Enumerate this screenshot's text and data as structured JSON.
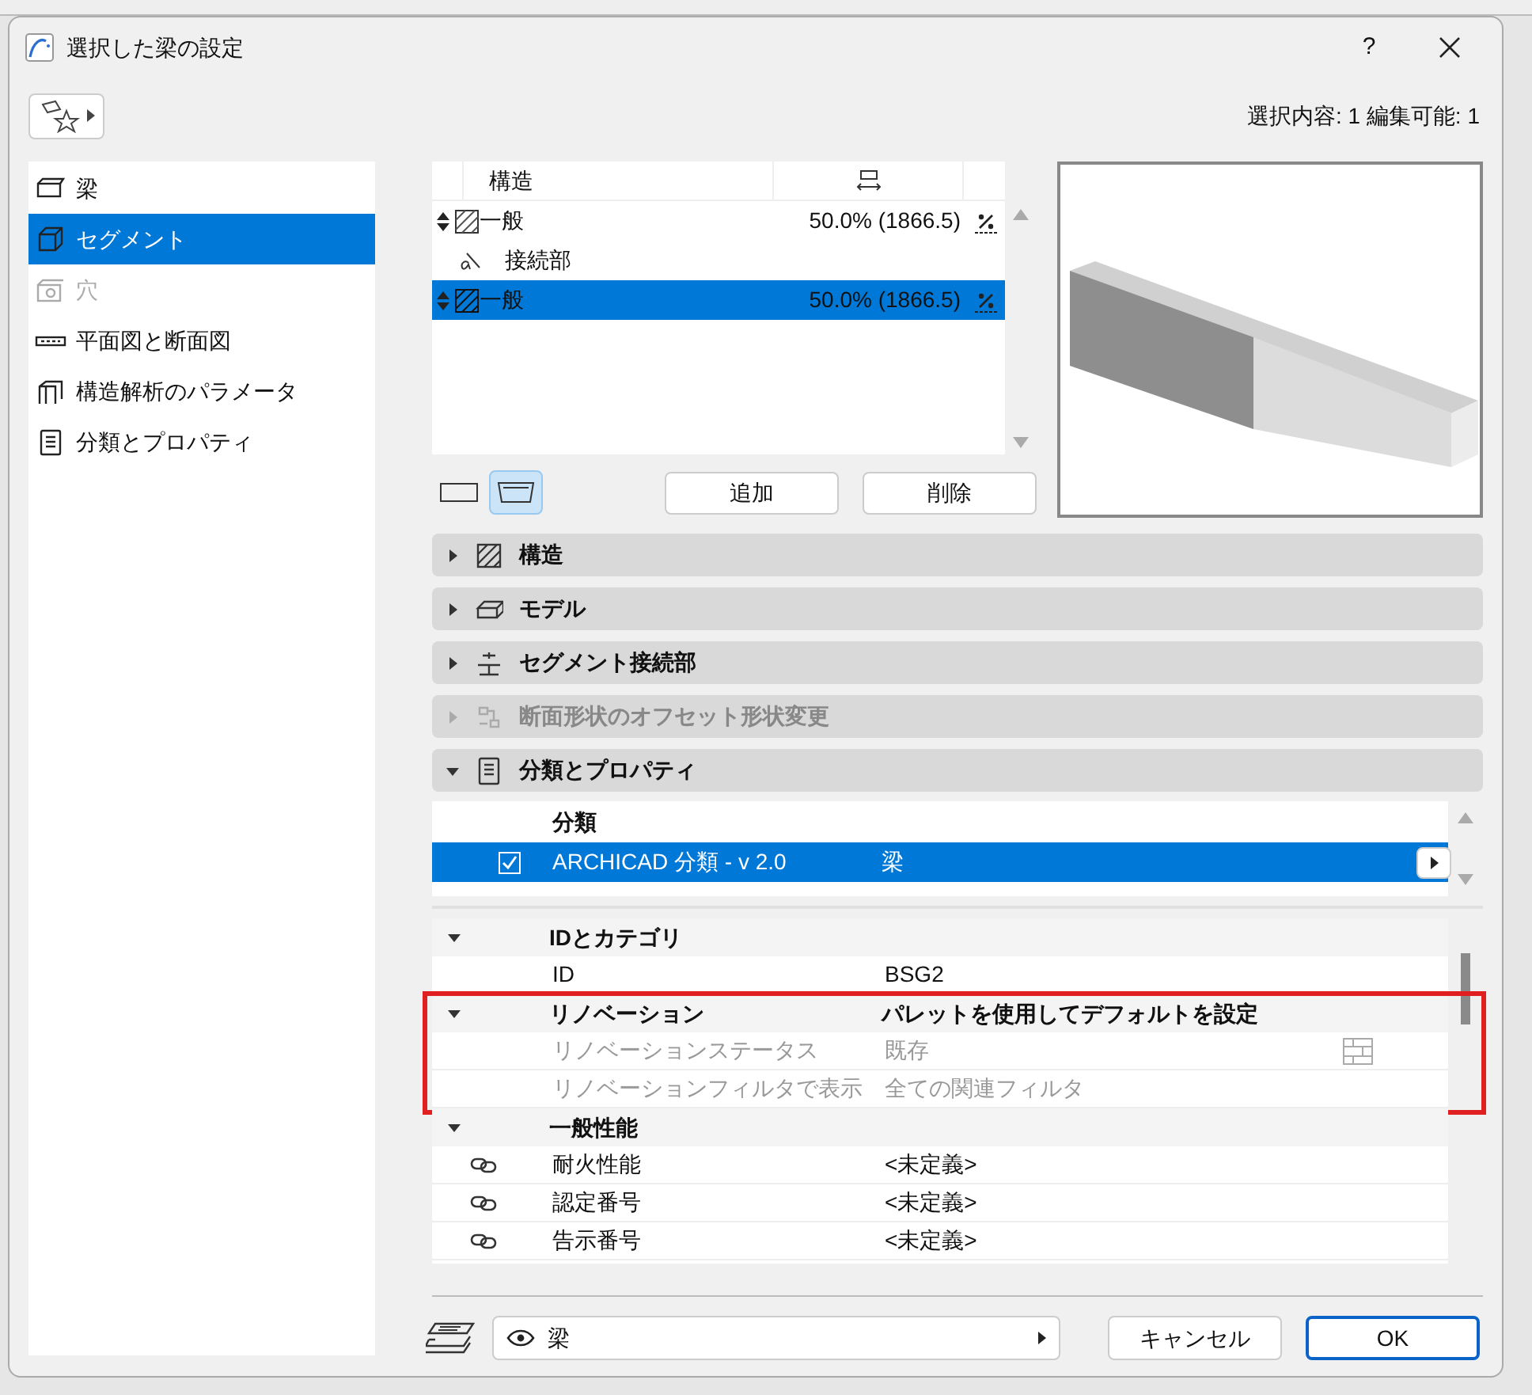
{
  "window": {
    "title": "選択した梁の設定",
    "help": "?"
  },
  "selection_info": "選択内容: 1 編集可能: 1",
  "sidebar": {
    "items": [
      {
        "kind": "beam",
        "label": "梁",
        "selected": false,
        "disabled": false
      },
      {
        "kind": "segment",
        "label": "セグメント",
        "selected": true,
        "disabled": false
      },
      {
        "kind": "hole",
        "label": "穴",
        "selected": false,
        "disabled": true
      },
      {
        "kind": "plan",
        "label": "平面図と断面図",
        "selected": false,
        "disabled": false
      },
      {
        "kind": "analysis",
        "label": "構造解析のパラメータ",
        "selected": false,
        "disabled": false
      },
      {
        "kind": "properties",
        "label": "分類とプロパティ",
        "selected": false,
        "disabled": false
      }
    ]
  },
  "segments": {
    "header": "構造",
    "rows": [
      {
        "kind": "segment",
        "name": "一般",
        "value": "50.0% (1866.5)",
        "selected": false
      },
      {
        "kind": "joint",
        "name": "接続部",
        "selected": false
      },
      {
        "kind": "segment",
        "name": "一般",
        "value": "50.0% (1866.5)",
        "selected": true
      }
    ]
  },
  "view_toggles": [
    {
      "kind": "flat",
      "selected": false
    },
    {
      "kind": "tapered",
      "selected": true
    }
  ],
  "segment_buttons": [
    "追加",
    "削除"
  ],
  "panels": [
    {
      "kind": "structure",
      "title": "構造",
      "expanded": false,
      "disabled": false
    },
    {
      "kind": "model",
      "title": "モデル",
      "expanded": false,
      "disabled": false
    },
    {
      "kind": "joint",
      "title": "セグメント接続部",
      "expanded": false,
      "disabled": false
    },
    {
      "kind": "offset",
      "title": "断面形状のオフセット形状変更",
      "expanded": false,
      "disabled": true
    },
    {
      "kind": "properties",
      "title": "分類とプロパティ",
      "expanded": true,
      "disabled": false
    }
  ],
  "classification": {
    "header": "分類",
    "rows": [
      {
        "checked": true,
        "system": "ARCHICAD 分類 - v 2.0",
        "value": "梁",
        "selected": true
      }
    ]
  },
  "properties": {
    "groups": [
      {
        "title": "IDとカテゴリ",
        "expanded": true,
        "highlighted": false,
        "rows": [
          {
            "kind": "plain",
            "label": "ID",
            "value": "BSG2",
            "disabled": false
          }
        ]
      },
      {
        "title": "リノベーション",
        "value": "パレットを使用してデフォルトを設定",
        "expanded": true,
        "highlighted": true,
        "rows": [
          {
            "kind": "renovation",
            "label": "リノベーションステータス",
            "value": "既存",
            "disabled": true
          },
          {
            "kind": "plain",
            "label": "リノベーションフィルタで表示",
            "value": "全ての関連フィルタ",
            "disabled": true
          }
        ]
      },
      {
        "title": "一般性能",
        "expanded": true,
        "highlighted": false,
        "rows": [
          {
            "kind": "linked",
            "label": "耐火性能",
            "value": "<未定義>",
            "disabled": false
          },
          {
            "kind": "linked",
            "label": "認定番号",
            "value": "<未定義>",
            "disabled": false
          },
          {
            "kind": "linked",
            "label": "告示番号",
            "value": "<未定義>",
            "disabled": false
          }
        ]
      }
    ]
  },
  "footer": {
    "layer": "梁",
    "buttons": [
      {
        "kind": "cancel",
        "label": "キャンセル"
      },
      {
        "kind": "ok",
        "label": "OK"
      }
    ]
  }
}
